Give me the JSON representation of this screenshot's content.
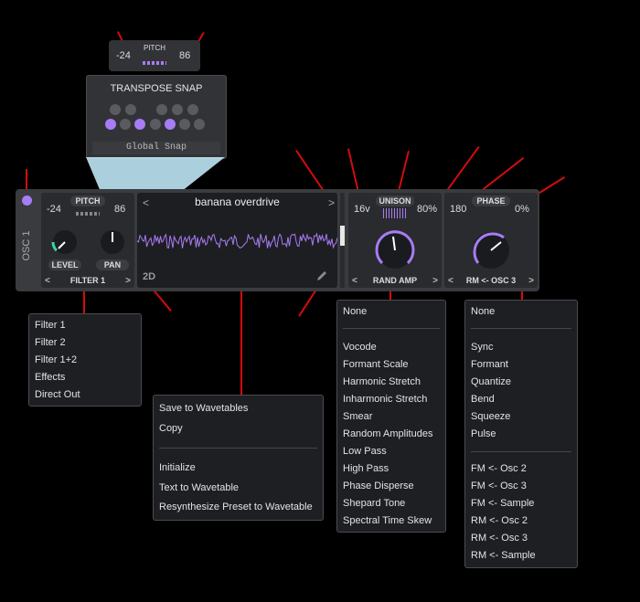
{
  "pitch_popup": {
    "title": "PITCH",
    "min": "-24",
    "max": "86"
  },
  "snap": {
    "title": "TRANSPOSE SNAP",
    "button": "Global Snap"
  },
  "osc": {
    "label": "OSC 1",
    "color": "#a77cf5"
  },
  "pitch": {
    "title": "PITCH",
    "min": "-24",
    "max": "86"
  },
  "level_label": "LEVEL",
  "pan_label": "PAN",
  "filter_select": "FILTER 1",
  "wavetable": {
    "name": "banana overdrive",
    "mode": "2D",
    "prev": "<",
    "next": ">"
  },
  "unison": {
    "title": "UNISON",
    "voices": "16v",
    "blend": "80%"
  },
  "phase": {
    "title": "PHASE",
    "value": "180",
    "rand": "0%"
  },
  "spectral_select": "RAND AMP",
  "distortion_select": "RM <- OSC 3",
  "filter_menu": [
    "Filter 1",
    "Filter 2",
    "Filter 1+2",
    "Effects",
    "Direct Out"
  ],
  "wavetable_menu": [
    "Save to Wavetables",
    "Copy",
    "Initialize",
    "Text to Wavetable",
    "Resynthesize Preset to Wavetable"
  ],
  "spectral_menu": [
    "None",
    "Vocode",
    "Formant Scale",
    "Harmonic Stretch",
    "Inharmonic Stretch",
    "Smear",
    "Random Amplitudes",
    "Low Pass",
    "High Pass",
    "Phase Disperse",
    "Shepard Tone",
    "Spectral Time Skew"
  ],
  "distortion_menu": [
    "None",
    "Sync",
    "Formant",
    "Quantize",
    "Bend",
    "Squeeze",
    "Pulse",
    "FM <- Osc 2",
    "FM <- Osc 3",
    "FM <- Sample",
    "RM <- Osc 2",
    "RM <- Osc 3",
    "RM <- Sample"
  ],
  "colors": {
    "accent": "#a77cf5",
    "annotation": "#d40c0c",
    "panel": "#2b2c2f"
  }
}
